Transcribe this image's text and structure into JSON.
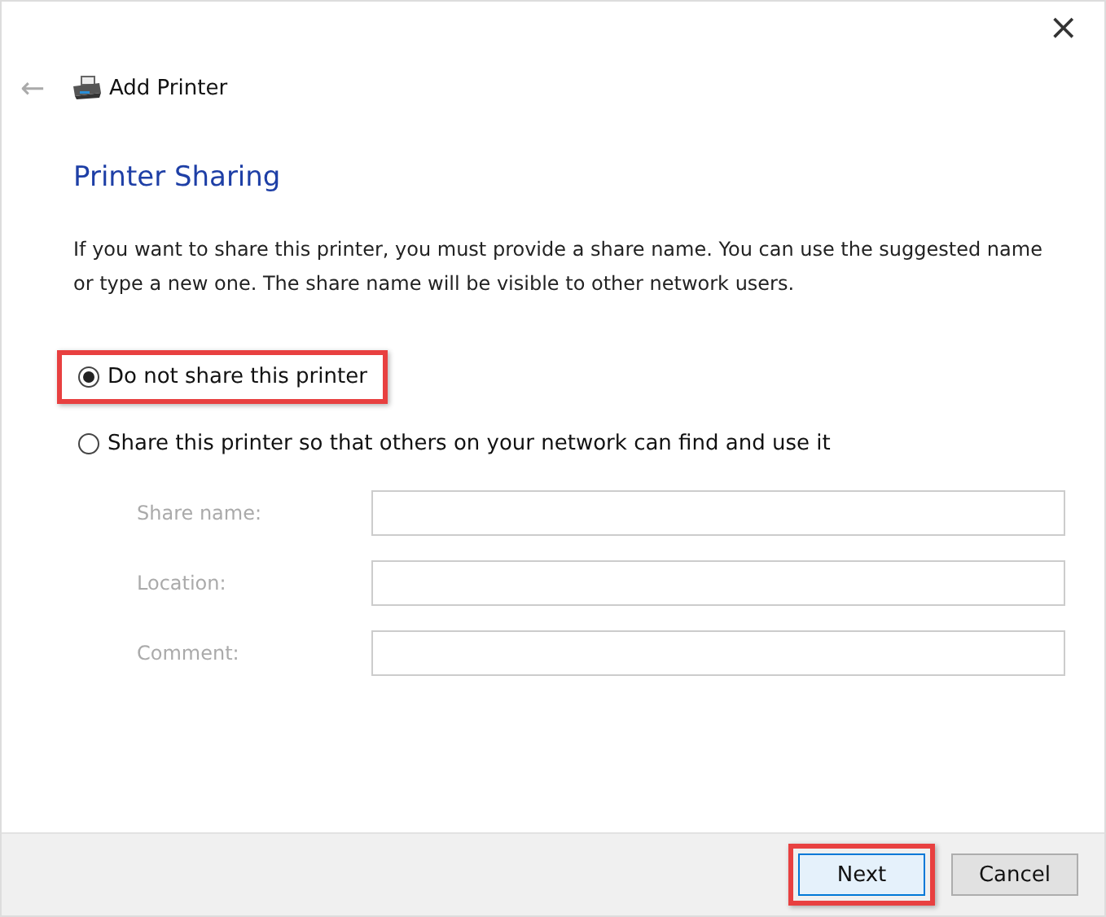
{
  "window": {
    "title": "Add Printer",
    "close": "×",
    "back": "←"
  },
  "heading": "Printer Sharing",
  "description": "If you want to share this printer, you must provide a share name. You can use the suggested name or type a new one. The share name will be visible to other network users.",
  "options": [
    {
      "label": "Do not share this printer",
      "selected": true,
      "highlighted": true
    },
    {
      "label": "Share this printer so that others on your network can find and use it",
      "selected": false,
      "highlighted": false
    }
  ],
  "fields": [
    {
      "label": "Share name:",
      "disabled": true
    },
    {
      "label": "Location:",
      "disabled": true
    },
    {
      "label": "Comment:",
      "disabled": true
    }
  ],
  "buttons": [
    {
      "label": "Next",
      "kind": "primary",
      "highlighted": true
    },
    {
      "label": "Cancel",
      "kind": "secondary",
      "highlighted": false
    }
  ]
}
